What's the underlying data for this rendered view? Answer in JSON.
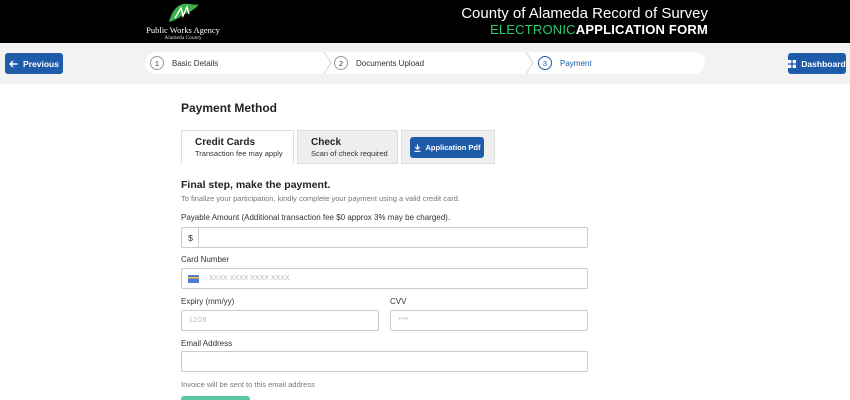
{
  "header": {
    "logo_name": "Public Works Agency",
    "logo_sub": "Alameda County",
    "title": "County of Alameda Record of Survey",
    "subtitle_green": "ELECTRONIC",
    "subtitle_white": "APPLICATION FORM"
  },
  "nav": {
    "previous_label": "Previous",
    "dashboard_label": "Dashboard",
    "steps": [
      {
        "num": "1",
        "label": "Basic Details"
      },
      {
        "num": "2",
        "label": "Documents Upload"
      },
      {
        "num": "3",
        "label": "Payment"
      }
    ],
    "active_step": 3
  },
  "main": {
    "title": "Payment Method",
    "tabs": [
      {
        "title": "Credit Cards",
        "sub": "Transaction fee may apply"
      },
      {
        "title": "Check",
        "sub": "Scan of check required"
      }
    ],
    "pdf_button": "Application Pdf",
    "step_heading": "Final step, make the payment.",
    "step_desc": "To finalize your participation, kindly complete your payment using a valid credit card.",
    "amount_label": "Payable Amount (Additional transaction fee $0 approx 3% may be charged).",
    "currency_symbol": "$",
    "amount_value": "",
    "card_label": "Card Number",
    "card_placeholder": "XXXX XXXX XXXX XXXX",
    "expiry_label": "Expiry (mm/yy)",
    "expiry_placeholder": "12/26",
    "cvv_label": "CVV",
    "cvv_placeholder": "****",
    "email_label": "Email Address",
    "email_value": "",
    "email_hint": "Invoice will be sent to this email address"
  },
  "colors": {
    "header_bg": "#000000",
    "accent_blue": "#1e5ba8",
    "green_text": "#2ecc71",
    "pay_button": "#59c8a3",
    "nav_bg": "#f2f2f2"
  }
}
